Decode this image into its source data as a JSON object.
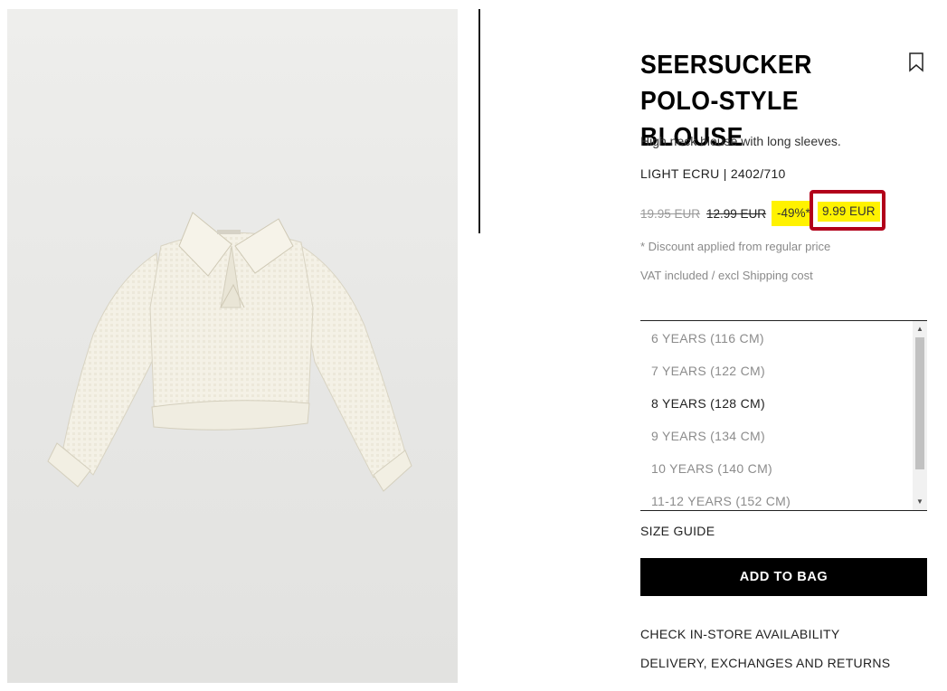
{
  "product": {
    "title": "SEERSUCKER POLO-STYLE BLOUSE",
    "description": "High neck blouse with long sleeves.",
    "color_ref": "LIGHT ECRU | 2402/710",
    "bookmark_icon": "bookmark-icon"
  },
  "prices": {
    "original": "19.95 EUR",
    "previous": "12.99 EUR",
    "discount": "-49%*",
    "current": "9.99 EUR",
    "highlight_color": "#fff200",
    "annotation_color": "#b2001a"
  },
  "notes": {
    "discount_note": "* Discount applied from regular price",
    "vat_note": "VAT included / excl Shipping cost"
  },
  "sizes": [
    {
      "label": "6 YEARS (116 CM)",
      "available": false
    },
    {
      "label": "7 YEARS (122 CM)",
      "available": false
    },
    {
      "label": "8 YEARS (128 CM)",
      "available": true
    },
    {
      "label": "9 YEARS (134 CM)",
      "available": false
    },
    {
      "label": "10 YEARS (140 CM)",
      "available": false
    },
    {
      "label": "11-12 YEARS (152 CM)",
      "available": false
    }
  ],
  "actions": {
    "size_guide": "SIZE GUIDE",
    "add_to_bag": "ADD TO BAG",
    "check_store": "CHECK IN-STORE AVAILABILITY",
    "delivery": "DELIVERY, EXCHANGES AND RETURNS"
  }
}
